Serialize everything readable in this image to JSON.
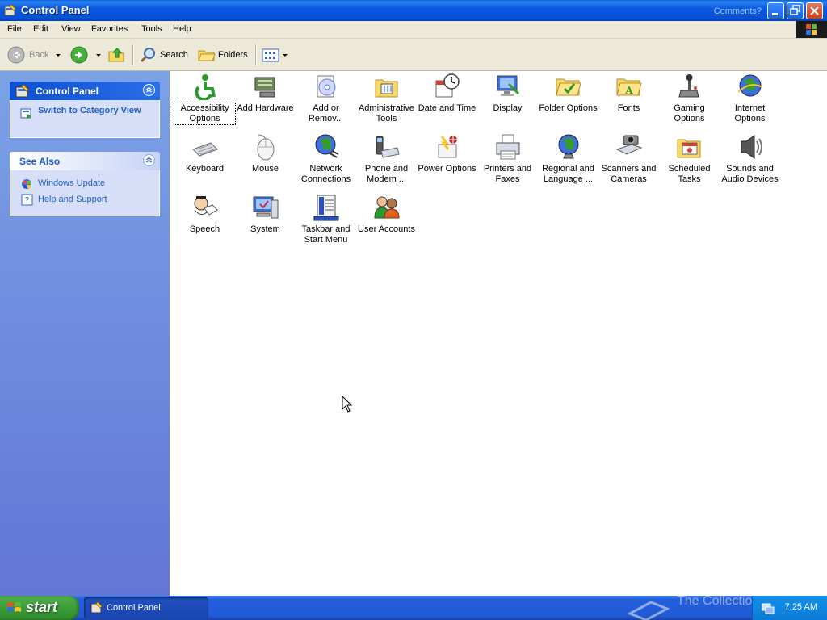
{
  "window": {
    "title": "Control Panel",
    "comments_link": "Comments?"
  },
  "menu": [
    "File",
    "Edit",
    "View",
    "Favorites",
    "Tools",
    "Help"
  ],
  "toolbar": {
    "back": "Back",
    "search": "Search",
    "folders": "Folders"
  },
  "sidebar": {
    "control_panel_title": "Control Panel",
    "switch_view": "Switch to Category View",
    "see_also_title": "See Also",
    "links": [
      "Windows Update",
      "Help and Support"
    ]
  },
  "items": [
    {
      "name": "Accessibility Options",
      "icon": "accessibility-icon",
      "selected": true
    },
    {
      "name": "Add Hardware",
      "icon": "add-hardware-icon"
    },
    {
      "name": "Add or Remov...",
      "icon": "add-remove-programs-icon"
    },
    {
      "name": "Administrative Tools",
      "icon": "administrative-tools-icon"
    },
    {
      "name": "Date and Time",
      "icon": "date-time-icon"
    },
    {
      "name": "Display",
      "icon": "display-icon"
    },
    {
      "name": "Folder Options",
      "icon": "folder-options-icon"
    },
    {
      "name": "Fonts",
      "icon": "fonts-icon"
    },
    {
      "name": "Gaming Options",
      "icon": "gaming-options-icon"
    },
    {
      "name": "Internet Options",
      "icon": "internet-options-icon"
    },
    {
      "name": "Keyboard",
      "icon": "keyboard-icon"
    },
    {
      "name": "Mouse",
      "icon": "mouse-icon"
    },
    {
      "name": "Network Connections",
      "icon": "network-connections-icon"
    },
    {
      "name": "Phone and Modem ...",
      "icon": "phone-modem-icon"
    },
    {
      "name": "Power Options",
      "icon": "power-options-icon"
    },
    {
      "name": "Printers and Faxes",
      "icon": "printers-faxes-icon"
    },
    {
      "name": "Regional and Language ...",
      "icon": "regional-language-icon"
    },
    {
      "name": "Scanners and Cameras",
      "icon": "scanners-cameras-icon"
    },
    {
      "name": "Scheduled Tasks",
      "icon": "scheduled-tasks-icon"
    },
    {
      "name": "Sounds and Audio Devices",
      "icon": "sounds-audio-icon"
    },
    {
      "name": "Speech",
      "icon": "speech-icon"
    },
    {
      "name": "System",
      "icon": "system-icon"
    },
    {
      "name": "Taskbar and Start Menu",
      "icon": "taskbar-start-menu-icon"
    },
    {
      "name": "User Accounts",
      "icon": "user-accounts-icon"
    }
  ],
  "taskbar": {
    "start_label": "start",
    "task_label": "Control Panel",
    "clock": "7:25 AM",
    "watermark": "The Collection Book"
  }
}
